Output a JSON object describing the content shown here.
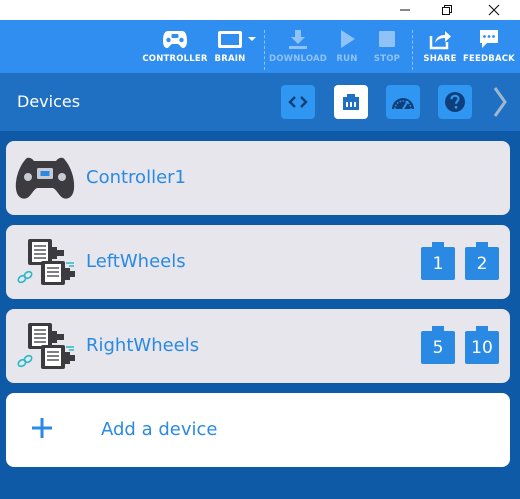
{
  "window": {
    "minimize_icon": "minimize-icon",
    "maximize_icon": "restore-icon",
    "close_icon": "close-icon"
  },
  "toolbar": {
    "controller_label": "CONTROLLER",
    "brain_label": "BRAIN",
    "download_label": "DOWNLOAD",
    "run_label": "RUN",
    "stop_label": "STOP",
    "share_label": "SHARE",
    "feedback_label": "FEEDBACK",
    "disabled_color": "#8fc3f7",
    "accent_color": "#2f8ef0"
  },
  "header": {
    "title": "Devices",
    "tabs": [
      {
        "icon": "code-icon",
        "active": false
      },
      {
        "icon": "port-icon",
        "active": true
      },
      {
        "icon": "dashboard-icon",
        "active": false
      },
      {
        "icon": "help-icon",
        "active": false
      }
    ],
    "next_icon": "chevron-right-icon"
  },
  "devices": [
    {
      "name": "Controller1",
      "icon": "controller-icon",
      "ports": []
    },
    {
      "name": "LeftWheels",
      "icon": "motor-group-icon",
      "ports": [
        "1",
        "2"
      ]
    },
    {
      "name": "RightWheels",
      "icon": "motor-group-icon",
      "ports": [
        "5",
        "10"
      ]
    }
  ],
  "add_device": {
    "label": "Add a device",
    "icon": "plus-icon"
  }
}
